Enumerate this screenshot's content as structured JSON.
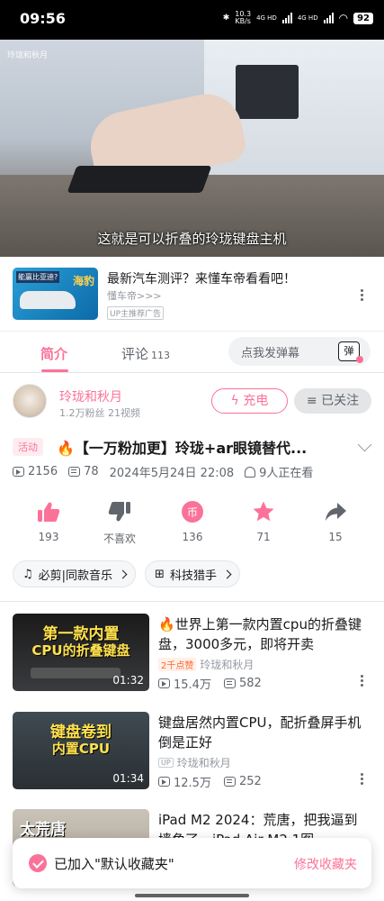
{
  "status_bar": {
    "time": "09:56",
    "net_speed": "10.3",
    "net_unit": "KB/s",
    "signal1": "4G HD",
    "signal2": "4G HD",
    "battery": "92"
  },
  "player": {
    "watermark": "玲珑和秋月",
    "subtitle": "这就是可以折叠的玲珑键盘主机"
  },
  "ad": {
    "thumb_text": "海豹",
    "thumb_question": "能赢比亚迪?",
    "title": "最新汽车测评？来懂车帝看看吧！",
    "source": "懂车帝>>>",
    "badge": "UP主推荐广告"
  },
  "tabs": {
    "intro": "简介",
    "comments": "评论",
    "comments_count": "113",
    "danmaku_placeholder": "点我发弹幕",
    "danmaku_icon": "弹"
  },
  "uploader": {
    "name": "玲珑和秋月",
    "meta": "1.2万粉丝  21视频",
    "charge_label": "充电",
    "followed_label": "已关注"
  },
  "video": {
    "activity_tag": "活动",
    "title": "🔥【一万粉加更】玲珑+ar眼镜替代...",
    "views": "2156",
    "danmaku": "78",
    "date": "2024年5月24日 22:08",
    "watching": "9人正在看"
  },
  "actions": {
    "like": "193",
    "dislike": "不喜欢",
    "coin": "136",
    "favorite": "71",
    "share": "15"
  },
  "tags": {
    "bgm": "必剪|同款音乐",
    "category": "科技猎手"
  },
  "recommendations": [
    {
      "thumb_line1": "第一款内置",
      "thumb_line2": "CPU的折叠键盘",
      "duration": "01:32",
      "title": "🔥世界上第一款内置cpu的折叠键盘，3000多元，即将开卖",
      "badge": "2千点赞",
      "author": "玲珑和秋月",
      "views": "15.4万",
      "danmaku": "582"
    },
    {
      "thumb_line1": "键盘卷到",
      "thumb_line2": "内置CPU",
      "duration": "01:34",
      "title": "键盘居然内置CPU，配折叠屏手机倒是正好",
      "badge": "UP",
      "author": "玲珑和秋月",
      "views": "12.5万",
      "danmaku": "252"
    },
    {
      "thumb_line1": "太荒唐",
      "thumb_line2": "",
      "duration": "",
      "title": "iPad M2 2024：荒唐，把我逼到墙角了，iPad Air M2 1图",
      "badge": "",
      "author": "",
      "views": "",
      "danmaku": ""
    }
  ],
  "toast": {
    "message": "已加入\"默认收藏夹\"",
    "action": "修改收藏夹"
  },
  "colors": {
    "accent": "#fb7299",
    "text": "#18191c",
    "muted": "#61666d"
  }
}
